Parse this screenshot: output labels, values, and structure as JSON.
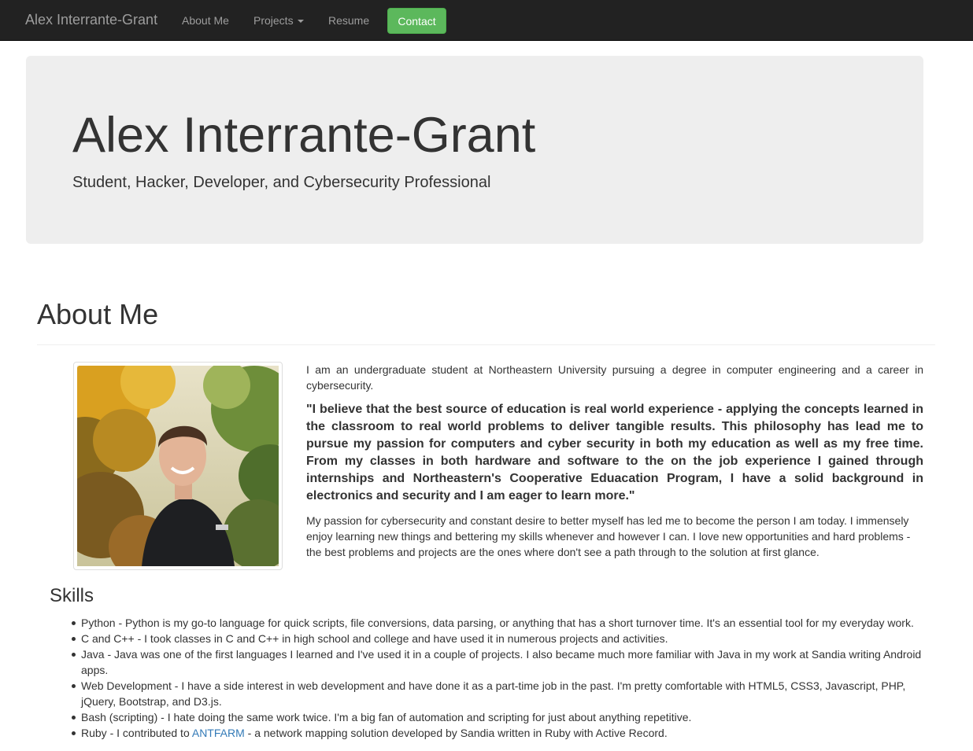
{
  "navbar": {
    "brand": "Alex Interrante-Grant",
    "links": [
      "About Me",
      "Projects",
      "Resume"
    ],
    "contact": "Contact"
  },
  "jumbotron": {
    "title": "Alex Interrante-Grant",
    "subtitle": "Student, Hacker, Developer, and Cybersecurity Professional"
  },
  "about": {
    "heading": "About Me",
    "intro": "I am an undergraduate student at Northeastern University pursuing a degree in computer engineering and a career in cybersecurity.",
    "quote": "\"I believe that the best source of education is real world experience - applying the concepts learned in the classroom to real world problems to deliver tangible results. This philosophy has lead me to pursue my passion for computers and cyber security in both my education as well as my free time. From my classes in both hardware and software to the on the job experience I gained through internships and Northeastern's Cooperative Eduacation Program, I have a solid background in electronics and security and I am eager to learn more.\"",
    "passion": "My passion for cybersecurity and constant desire to better myself has led me to become the person I am today. I immensely enjoy learning new things and bettering my skills whenever and however I can. I love new opportunities and hard problems - the best problems and projects are the ones where don't see a path through to the solution at first glance."
  },
  "skills": {
    "heading": "Skills",
    "items": [
      "Python - Python is my go-to language for quick scripts, file conversions, data parsing, or anything that has a short turnover time. It's an essential tool for my everyday work.",
      "C and C++ - I took classes in C and C++ in high school and college and have used it in numerous projects and activities.",
      "Java - Java was one of the first languages I learned and I've used it in a couple of projects. I also became much more familiar with Java in my work at Sandia writing Android apps.",
      "Web Development - I have a side interest in web development and have done it as a part-time job in the past. I'm pretty comfortable with HTML5, CSS3, Javascript, PHP, jQuery, Bootstrap, and D3.js.",
      "Bash (scripting) - I hate doing the same work twice. I'm a big fan of automation and scripting for just about anything repetitive."
    ],
    "ruby_prefix": "Ruby - I contributed to ",
    "ruby_link": "ANTFARM",
    "ruby_suffix": " - a network mapping solution developed by Sandia written in Ruby with Active Record."
  }
}
